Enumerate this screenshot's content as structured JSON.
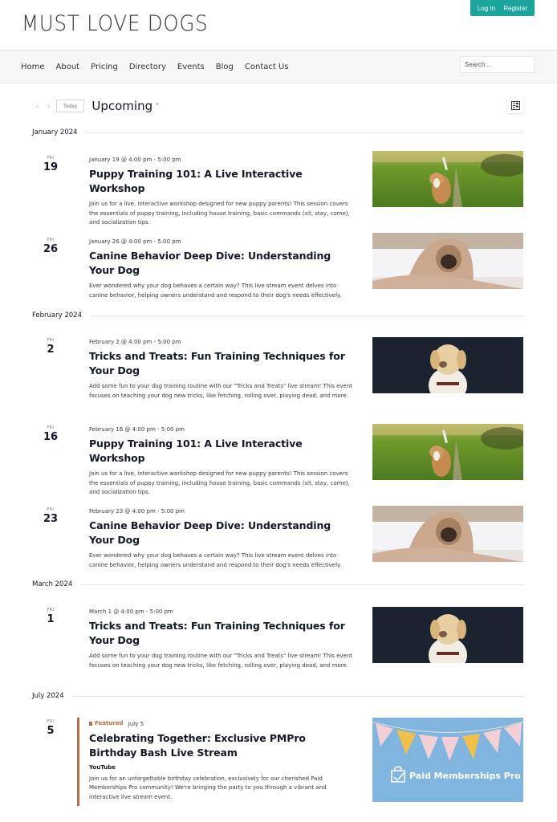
{
  "site": {
    "logo_text": "MUST LOVE DOGS",
    "account": {
      "login_label": "Log In",
      "register_label": "Register"
    },
    "nav": [
      {
        "label": "Home"
      },
      {
        "label": "About"
      },
      {
        "label": "Pricing"
      },
      {
        "label": "Directory"
      },
      {
        "label": "Events"
      },
      {
        "label": "Blog"
      },
      {
        "label": "Contact Us"
      }
    ],
    "search": {
      "placeholder": "Search ..",
      "value": ""
    },
    "colors": {
      "accent": "#1aa49b",
      "featured": "#c06b3f",
      "text": "#141827"
    }
  },
  "toolbar": {
    "prev_icon": "chevron-left-icon",
    "next_icon": "chevron-right-icon",
    "today_label": "Today",
    "view_title": "Upcoming",
    "view_chevron": "⌄",
    "view_switch_icon": "list-view-icon"
  },
  "months": [
    {
      "label": "January 2024"
    },
    {
      "label": "February 2024"
    },
    {
      "label": "March 2024"
    },
    {
      "label": "July 2024"
    }
  ],
  "events": [
    {
      "weekday": "FRI",
      "day": "19",
      "datetime": "January 19 @ 4:00 pm - 5:00 pm",
      "title": "Puppy Training 101: A Live Interactive Workshop",
      "description": "Join us for a live, interactive workshop designed for new puppy parents! This session covers the essentials of puppy training, including house training, basic commands (sit, stay, come), and socialization tips.",
      "image": "beagle-running-in-grass"
    },
    {
      "weekday": "FRI",
      "day": "26",
      "datetime": "January 26 @ 4:00 pm - 5:00 pm",
      "title": "Canine Behavior Deep Dive: Understanding Your Dog",
      "description": "Ever wondered why your dog behaves a certain way? This live stream event delves into canine behavior, helping owners understand and respond to their dog's needs effectively.",
      "image": "pug-in-blanket"
    },
    {
      "weekday": "FRI",
      "day": "2",
      "datetime": "February 2 @ 4:00 pm - 5:00 pm",
      "title": "Tricks and Treats: Fun Training Techniques for Your Dog",
      "description": "Add some fun to your dog training routine with our \"Tricks and Treats\" live stream! This event focuses on teaching your dog new tricks, like fetching, rolling over, playing dead, and more.",
      "image": "labrador-dark-background"
    },
    {
      "weekday": "FRI",
      "day": "16",
      "datetime": "February 16 @ 4:00 pm - 5:00 pm",
      "title": "Puppy Training 101: A Live Interactive Workshop",
      "description": "Join us for a live, interactive workshop designed for new puppy parents! This session covers the essentials of puppy training, including house training, basic commands (sit, stay, come), and socialization tips.",
      "image": "beagle-running-in-grass"
    },
    {
      "weekday": "FRI",
      "day": "23",
      "datetime": "February 23 @ 4:00 pm - 5:00 pm",
      "title": "Canine Behavior Deep Dive: Understanding Your Dog",
      "description": "Ever wondered why your dog behaves a certain way? This live stream event delves into canine behavior, helping owners understand and respond to their dog's needs effectively.",
      "image": "pug-in-blanket"
    },
    {
      "weekday": "FRI",
      "day": "1",
      "datetime": "March 1 @ 4:00 pm - 5:00 pm",
      "title": "Tricks and Treats: Fun Training Techniques for Your Dog",
      "description": "Add some fun to your dog training routine with our \"Tricks and Treats\" live stream! This event focuses on teaching your dog new tricks, like fetching, rolling over, playing dead, and more.",
      "image": "labrador-dark-background"
    },
    {
      "weekday": "FRI",
      "day": "5",
      "featured_label": "Featured",
      "datetime": "July 5",
      "title": "Celebrating Together: Exclusive PMPro Birthday Bash Live Stream",
      "venue": "YouTube",
      "description": "Join us for an unforgettable birthday celebration, exclusively for our cherished Paid Memberships Pro community! We're bringing the party to you through a vibrant and interactive live stream event.",
      "image": "pmpro-bunting-banner",
      "image_caption": "Paid Memberships Pro"
    }
  ]
}
